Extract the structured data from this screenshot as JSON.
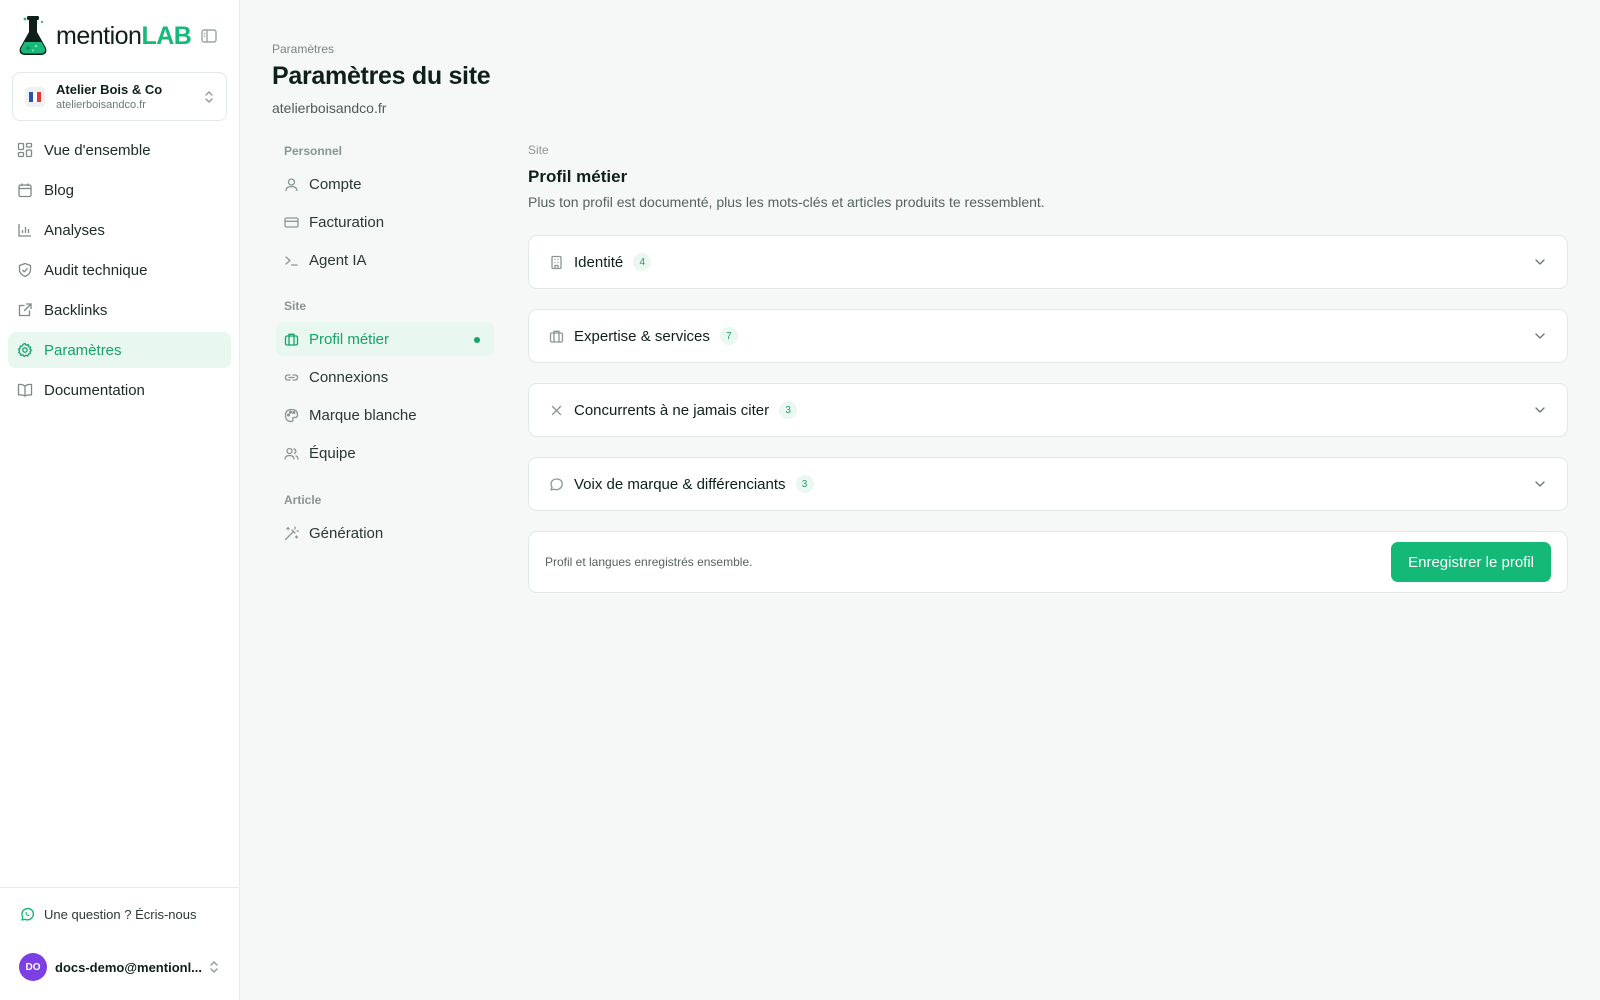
{
  "brand": {
    "name_part1": "mention",
    "name_part2": "LAB",
    "accent": "#18b878"
  },
  "site_switcher": {
    "name": "Atelier Bois & Co",
    "domain": "atelierboisandco.fr",
    "flag": "FR"
  },
  "sidebar": {
    "items": [
      {
        "label": "Vue d'ensemble",
        "icon": "dashboard-icon"
      },
      {
        "label": "Blog",
        "icon": "calendar-icon"
      },
      {
        "label": "Analyses",
        "icon": "bar-chart-icon"
      },
      {
        "label": "Audit technique",
        "icon": "shield-check-icon"
      },
      {
        "label": "Backlinks",
        "icon": "external-link-icon"
      },
      {
        "label": "Paramètres",
        "icon": "gear-icon",
        "active": true
      },
      {
        "label": "Documentation",
        "icon": "book-icon"
      }
    ],
    "help": "Une question ? Écris-nous",
    "user": {
      "initials": "DO",
      "email": "docs-demo@mentionl..."
    }
  },
  "header": {
    "breadcrumb": "Paramètres",
    "title": "Paramètres du site",
    "subtitle": "atelierboisandco.fr"
  },
  "settings_nav": {
    "sections": [
      {
        "title": "Personnel",
        "items": [
          {
            "label": "Compte",
            "icon": "user-icon"
          },
          {
            "label": "Facturation",
            "icon": "credit-card-icon"
          },
          {
            "label": "Agent IA",
            "icon": "terminal-icon"
          }
        ]
      },
      {
        "title": "Site",
        "items": [
          {
            "label": "Profil métier",
            "icon": "briefcase-icon",
            "active": true
          },
          {
            "label": "Connexions",
            "icon": "link-icon"
          },
          {
            "label": "Marque blanche",
            "icon": "palette-icon"
          },
          {
            "label": "Équipe",
            "icon": "users-icon"
          }
        ]
      },
      {
        "title": "Article",
        "items": [
          {
            "label": "Génération",
            "icon": "magic-wand-icon"
          }
        ]
      }
    ]
  },
  "content": {
    "eyebrow": "Site",
    "title": "Profil métier",
    "description": "Plus ton profil est documenté, plus les mots-clés et articles produits te ressemblent.",
    "sections": [
      {
        "label": "Identité",
        "count": "4",
        "icon": "building-icon"
      },
      {
        "label": "Expertise & services",
        "count": "7",
        "icon": "briefcase-icon"
      },
      {
        "label": "Concurrents à ne jamais citer",
        "count": "3",
        "icon": "close-icon"
      },
      {
        "label": "Voix de marque & différenciants",
        "count": "3",
        "icon": "chat-bubble-icon"
      }
    ],
    "save_note": "Profil et langues enregistrés ensemble.",
    "save_label": "Enregistrer le profil"
  }
}
